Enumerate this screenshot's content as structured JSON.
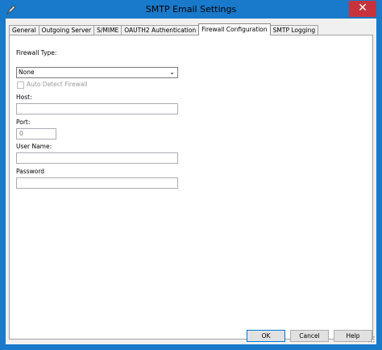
{
  "window": {
    "title": "SMTP Email Settings",
    "close_glyph": "✕",
    "app_icon": "pen-icon"
  },
  "tabs": [
    {
      "label": "General"
    },
    {
      "label": "Outgoing Server"
    },
    {
      "label": "S/MIME"
    },
    {
      "label": "OAUTH2 Authentication"
    },
    {
      "label": "Firewall Configuration",
      "active": true
    },
    {
      "label": "SMTP Logging"
    }
  ],
  "form": {
    "firewall_type_label": "Firewall Type:",
    "firewall_type_value": "None",
    "auto_detect_label": "Auto Detect Firewall",
    "host_label": "Host:",
    "host_value": "",
    "port_label": "Port:",
    "port_value": "0",
    "username_label": "User Name:",
    "username_value": "",
    "password_label": "Password",
    "password_value": ""
  },
  "buttons": {
    "ok": "OK",
    "cancel": "Cancel",
    "help": "Help"
  },
  "colors": {
    "titlebar": "#1979ca",
    "close": "#c7333c"
  }
}
